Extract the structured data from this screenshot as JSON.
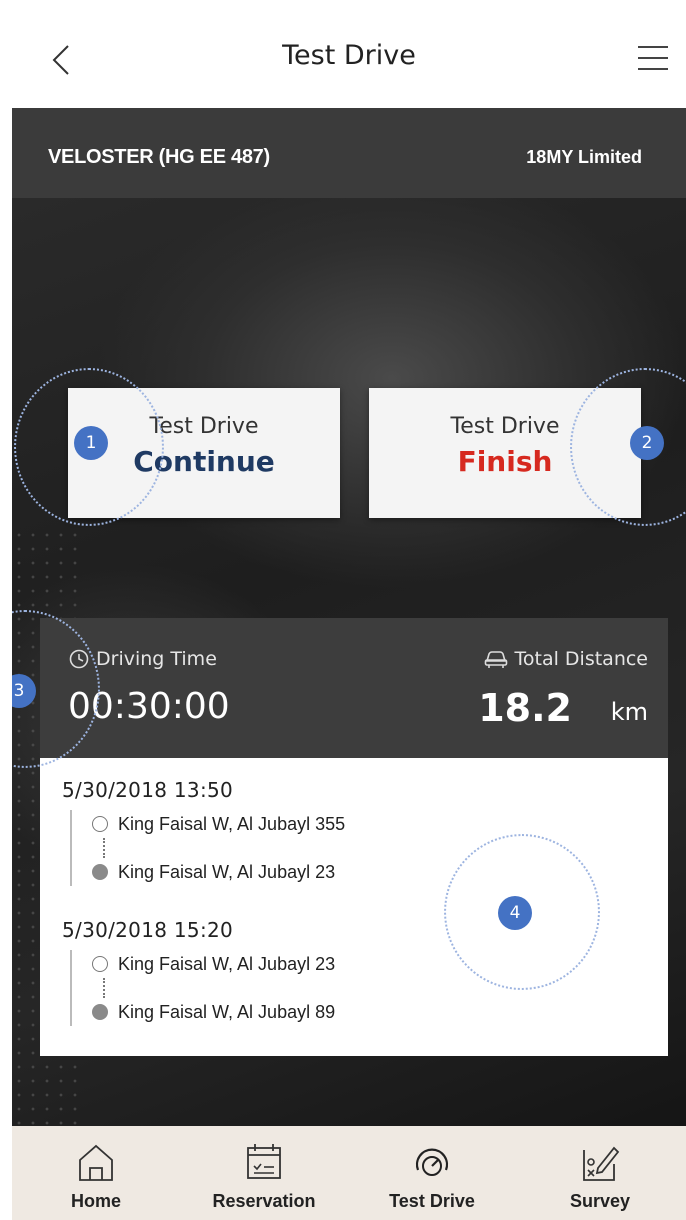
{
  "header": {
    "title": "Test Drive",
    "back_icon": "chevron-left-icon",
    "menu_icon": "hamburger-menu-icon"
  },
  "vehicle": {
    "model": "VELOSTER (HG EE 487)",
    "trim": "18MY Limited"
  },
  "actions": {
    "continue": {
      "line1": "Test Drive",
      "line2": "Continue",
      "color": "#1f3a63"
    },
    "finish": {
      "line1": "Test Drive",
      "line2": "Finish",
      "color": "#d6291f"
    }
  },
  "stats": {
    "driving_time_label": "Driving Time",
    "driving_time_value": "00:30:00",
    "total_distance_label": "Total Distance",
    "total_distance_value": "18.2",
    "total_distance_unit": "km"
  },
  "trips": [
    {
      "datetime": "5/30/2018  13:50",
      "from": "King Faisal W, Al Jubayl 355",
      "to": "King Faisal W, Al Jubayl 23"
    },
    {
      "datetime": "5/30/2018  15:20",
      "from": "King Faisal W, Al Jubayl 23",
      "to": "King Faisal W, Al Jubayl 89"
    }
  ],
  "annotations": [
    "1",
    "2",
    "3",
    "4"
  ],
  "tabs": [
    {
      "label": "Home",
      "icon": "home-icon"
    },
    {
      "label": "Reservation",
      "icon": "calendar-icon"
    },
    {
      "label": "Test Drive",
      "icon": "speedometer-icon"
    },
    {
      "label": "Survey",
      "icon": "survey-edit-icon"
    }
  ],
  "colors": {
    "accent_badge": "#4472c4",
    "tabbar_bg": "#efe9e2",
    "infobar_bg": "#3b3b3b"
  }
}
